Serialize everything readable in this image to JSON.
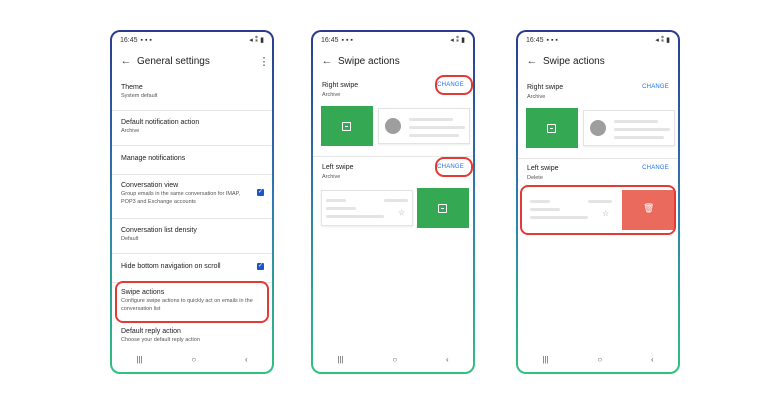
{
  "colors": {
    "accent": "#1a73e8",
    "highlight": "#e53935",
    "archive_green": "#34a853",
    "delete_red": "#ea6a5e"
  },
  "status": {
    "time": "16:45"
  },
  "screen1": {
    "title": "General settings",
    "items": [
      {
        "title": "Theme",
        "subtitle": "System default"
      },
      {
        "title": "Default notification action",
        "subtitle": "Archive"
      },
      {
        "title": "Manage notifications"
      },
      {
        "title": "Conversation view",
        "subtitle": "Group emails in the same conversation for IMAP, POP3 and Exchange accounts",
        "checked": true
      },
      {
        "title": "Conversation list density",
        "subtitle": "Default"
      },
      {
        "title": "Hide bottom navigation on scroll",
        "checked": true
      },
      {
        "title": "Swipe actions",
        "subtitle": "Configure swipe actions to quickly act on emails in the conversation list"
      },
      {
        "title": "Default reply action",
        "subtitle": "Choose your default reply action"
      }
    ]
  },
  "screen2": {
    "title": "Swipe actions",
    "right_swipe": {
      "title": "Right swipe",
      "subtitle": "Archive",
      "change": "CHANGE"
    },
    "left_swipe": {
      "title": "Left swipe",
      "subtitle": "Archive",
      "change": "CHANGE"
    }
  },
  "screen3": {
    "title": "Swipe actions",
    "right_swipe": {
      "title": "Right swipe",
      "subtitle": "Archive",
      "change": "CHANGE"
    },
    "left_swipe": {
      "title": "Left swipe",
      "subtitle": "Delete",
      "change": "CHANGE"
    }
  },
  "icons": {
    "status": "signal-wifi-battery-icons",
    "back": "arrow-left-icon",
    "more": "more-vert-icon",
    "archive": "archive-icon",
    "delete": "trash-icon",
    "avatar": "person-icon",
    "star": "star-outline-icon",
    "nav": [
      "recent-apps-icon",
      "home-icon",
      "back-nav-icon"
    ]
  }
}
